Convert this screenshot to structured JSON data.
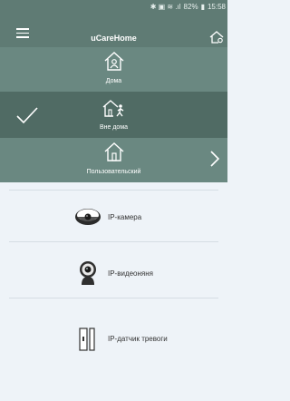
{
  "status": {
    "icons": "✱ ▣ ≋ .ıl",
    "battery": "82%",
    "time": "15:58"
  },
  "app": {
    "title": "uCareHome"
  },
  "modes": [
    {
      "label": "Дома",
      "icon": "home-user-icon"
    },
    {
      "label": "Вне дома",
      "icon": "home-away-icon",
      "selected": true
    },
    {
      "label": "Пользовательский",
      "icon": "home-custom-icon"
    }
  ],
  "devices": [
    {
      "label": "IP-камера",
      "icon": "ip-camera-icon"
    },
    {
      "label": "IP-видеоняня",
      "icon": "baby-monitor-icon"
    },
    {
      "label": "IP-датчик тревоги",
      "icon": "alarm-sensor-icon"
    }
  ],
  "colors": {
    "header": "#5f7b74",
    "mode_bg": "#6a8881",
    "mode_selected": "#506b64",
    "list_bg": "#eef3f8"
  }
}
